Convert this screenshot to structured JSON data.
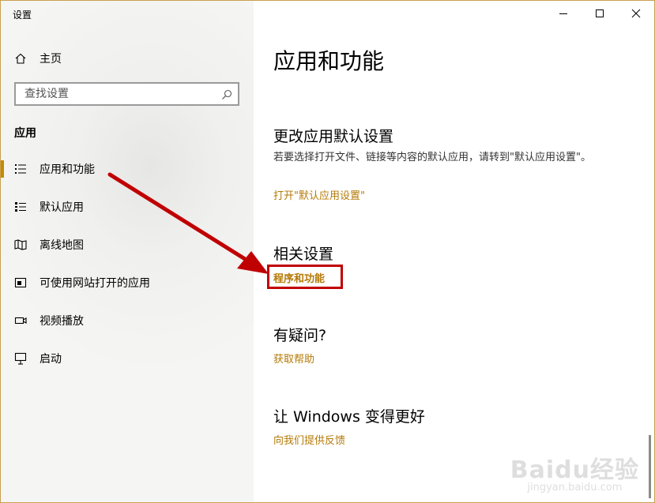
{
  "window": {
    "title": "设置"
  },
  "sidebar": {
    "home_label": "主页",
    "search_placeholder": "查找设置",
    "section": "应用",
    "items": [
      {
        "label": "应用和功能",
        "icon": "list-icon",
        "active": true
      },
      {
        "label": "默认应用",
        "icon": "default-apps-icon",
        "active": false
      },
      {
        "label": "离线地图",
        "icon": "map-icon",
        "active": false
      },
      {
        "label": "可使用网站打开的应用",
        "icon": "website-apps-icon",
        "active": false
      },
      {
        "label": "视频播放",
        "icon": "video-icon",
        "active": false
      },
      {
        "label": "启动",
        "icon": "startup-icon",
        "active": false
      }
    ]
  },
  "main": {
    "title": "应用和功能",
    "default_section": {
      "heading": "更改应用默认设置",
      "description": "若要选择打开文件、链接等内容的默认应用，请转到\"默认应用设置\"。",
      "link": "打开\"默认应用设置\""
    },
    "related": {
      "heading": "相关设置",
      "link": "程序和功能"
    },
    "question": {
      "heading": "有疑问?",
      "link": "获取帮助"
    },
    "improve": {
      "heading": "让 Windows 变得更好",
      "link": "向我们提供反馈"
    }
  },
  "colors": {
    "accent": "#c38a00",
    "link": "#b47a08",
    "annotation": "#c00000"
  },
  "watermark": {
    "logo": "Baidu经验",
    "url": "jingyan.baidu.com"
  }
}
